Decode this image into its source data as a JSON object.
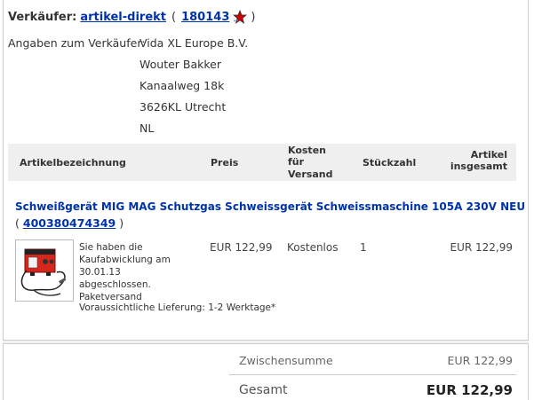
{
  "seller": {
    "label": "Verkäufer:",
    "name": "artikel-direkt",
    "open_paren": "(",
    "rating": "180143",
    "close_paren": ")",
    "star_color": "#cc0000"
  },
  "seller_info": {
    "label": "Angaben zum Verkäufer:",
    "address_lines": [
      "Vida XL Europe B.V.",
      "Wouter Bakker",
      "Kanaalweg 18k",
      "3626KL Utrecht",
      "NL"
    ]
  },
  "table_headers": {
    "item": "Artikelbezeichnung",
    "price": "Preis",
    "shipping_line1": "Kosten",
    "shipping_line2": "für",
    "shipping_line3": "Versand",
    "quantity": "Stückzahl",
    "total_line1": "Artikel",
    "total_line2": "insgesamt"
  },
  "item": {
    "title": "Schweißgerät MIG MAG Schutzgas Schweissgerät Schweissmaschine 105A 230V NEU",
    "open_paren": "(",
    "number": "400380474349",
    "close_paren": ")",
    "desc_line1": "Sie haben die",
    "desc_line2": "Kaufabwicklung am 30.01.13",
    "desc_line3": "abgeschlossen.",
    "desc_line4": "Paketversand",
    "price": "EUR 122,99",
    "shipping": "Kostenlos",
    "quantity": "1",
    "total": "EUR 122,99",
    "delivery": "Voraussichtliche Lieferung: 1-2 Werktage*"
  },
  "summary": {
    "subtotal_label": "Zwischensumme",
    "subtotal_value": "EUR 122,99",
    "total_label": "Gesamt",
    "total_value": "EUR 122,99"
  }
}
